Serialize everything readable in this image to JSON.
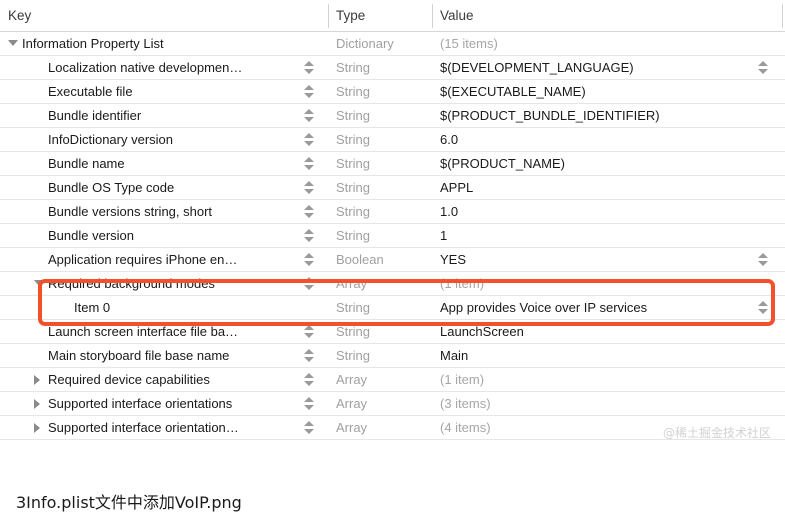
{
  "table": {
    "columns": {
      "key": "Key",
      "type": "Type",
      "value": "Value"
    },
    "rows": [
      {
        "key": "Information Property List",
        "type": "Dictionary",
        "value": "(15 items)",
        "indent": 0,
        "disclosure": "open",
        "stepper_key": false,
        "stepper_value": false,
        "value_muted": true
      },
      {
        "key": "Localization native developmen…",
        "type": "String",
        "value": "$(DEVELOPMENT_LANGUAGE)",
        "indent": 1,
        "disclosure": "none",
        "stepper_key": true,
        "stepper_value": true,
        "value_muted": false
      },
      {
        "key": "Executable file",
        "type": "String",
        "value": "$(EXECUTABLE_NAME)",
        "indent": 1,
        "disclosure": "none",
        "stepper_key": true,
        "stepper_value": false,
        "value_muted": false
      },
      {
        "key": "Bundle identifier",
        "type": "String",
        "value": "$(PRODUCT_BUNDLE_IDENTIFIER)",
        "indent": 1,
        "disclosure": "none",
        "stepper_key": true,
        "stepper_value": false,
        "value_muted": false
      },
      {
        "key": "InfoDictionary version",
        "type": "String",
        "value": "6.0",
        "indent": 1,
        "disclosure": "none",
        "stepper_key": true,
        "stepper_value": false,
        "value_muted": false
      },
      {
        "key": "Bundle name",
        "type": "String",
        "value": "$(PRODUCT_NAME)",
        "indent": 1,
        "disclosure": "none",
        "stepper_key": true,
        "stepper_value": false,
        "value_muted": false
      },
      {
        "key": "Bundle OS Type code",
        "type": "String",
        "value": "APPL",
        "indent": 1,
        "disclosure": "none",
        "stepper_key": true,
        "stepper_value": false,
        "value_muted": false
      },
      {
        "key": "Bundle versions string, short",
        "type": "String",
        "value": "1.0",
        "indent": 1,
        "disclosure": "none",
        "stepper_key": true,
        "stepper_value": false,
        "value_muted": false
      },
      {
        "key": "Bundle version",
        "type": "String",
        "value": "1",
        "indent": 1,
        "disclosure": "none",
        "stepper_key": true,
        "stepper_value": false,
        "value_muted": false
      },
      {
        "key": "Application requires iPhone en…",
        "type": "Boolean",
        "value": "YES",
        "indent": 1,
        "disclosure": "none",
        "stepper_key": true,
        "stepper_value": true,
        "value_muted": false
      },
      {
        "key": "Required background modes",
        "type": "Array",
        "value": "(1 item)",
        "indent": 1,
        "disclosure": "open",
        "stepper_key": true,
        "stepper_value": false,
        "value_muted": true
      },
      {
        "key": "Item 0",
        "type": "String",
        "value": "App provides Voice over IP services",
        "indent": 2,
        "disclosure": "none",
        "stepper_key": false,
        "stepper_value": true,
        "value_muted": false
      },
      {
        "key": "Launch screen interface file ba…",
        "type": "String",
        "value": "LaunchScreen",
        "indent": 1,
        "disclosure": "none",
        "stepper_key": true,
        "stepper_value": false,
        "value_muted": false
      },
      {
        "key": "Main storyboard file base name",
        "type": "String",
        "value": "Main",
        "indent": 1,
        "disclosure": "none",
        "stepper_key": true,
        "stepper_value": false,
        "value_muted": false
      },
      {
        "key": "Required device capabilities",
        "type": "Array",
        "value": "(1 item)",
        "indent": 1,
        "disclosure": "closed",
        "stepper_key": true,
        "stepper_value": false,
        "value_muted": true
      },
      {
        "key": "Supported interface orientations",
        "type": "Array",
        "value": "(3 items)",
        "indent": 1,
        "disclosure": "closed",
        "stepper_key": true,
        "stepper_value": false,
        "value_muted": true
      },
      {
        "key": "Supported interface orientation…",
        "type": "Array",
        "value": "(4 items)",
        "indent": 1,
        "disclosure": "closed",
        "stepper_key": true,
        "stepper_value": false,
        "value_muted": true
      }
    ]
  },
  "highlight": {
    "color": "#f2512c",
    "rows": [
      "Required background modes",
      "Item 0"
    ]
  },
  "watermark": {
    "text": "@稀土掘金技术社区"
  },
  "caption": {
    "text": "3Info.plist文件中添加VoIP.png"
  }
}
